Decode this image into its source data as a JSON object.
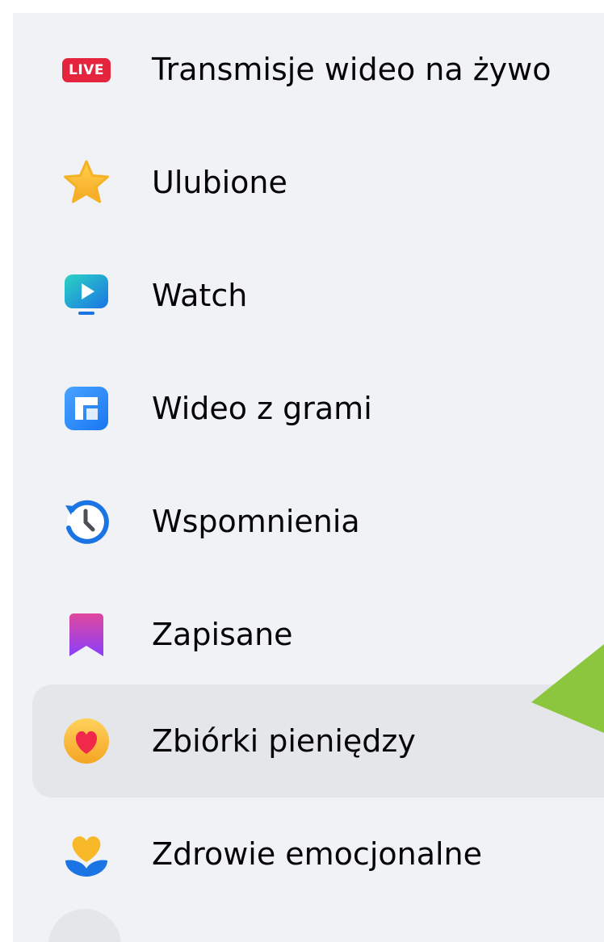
{
  "menu": {
    "items": [
      {
        "label": "Transmisje wideo na żywo",
        "icon": "live-icon",
        "badge": "LIVE",
        "active": false
      },
      {
        "label": "Ulubione",
        "icon": "star-icon",
        "active": false
      },
      {
        "label": "Watch",
        "icon": "watch-play-icon",
        "active": false
      },
      {
        "label": "Wideo z grami",
        "icon": "gaming-video-icon",
        "active": false
      },
      {
        "label": "Wspomnienia",
        "icon": "memories-clock-icon",
        "active": false
      },
      {
        "label": "Zapisane",
        "icon": "bookmark-icon",
        "active": false
      },
      {
        "label": "Zbiórki pieniędzy",
        "icon": "fundraiser-heart-icon",
        "active": true
      },
      {
        "label": "Zdrowie emocjonalne",
        "icon": "emotional-health-icon",
        "active": false
      }
    ]
  },
  "colors": {
    "panel_background": "#f0f2f5",
    "active_item_background": "#e4e6e9",
    "live_badge": "#e4253d",
    "pointer_arrow": "#8cc63f"
  }
}
